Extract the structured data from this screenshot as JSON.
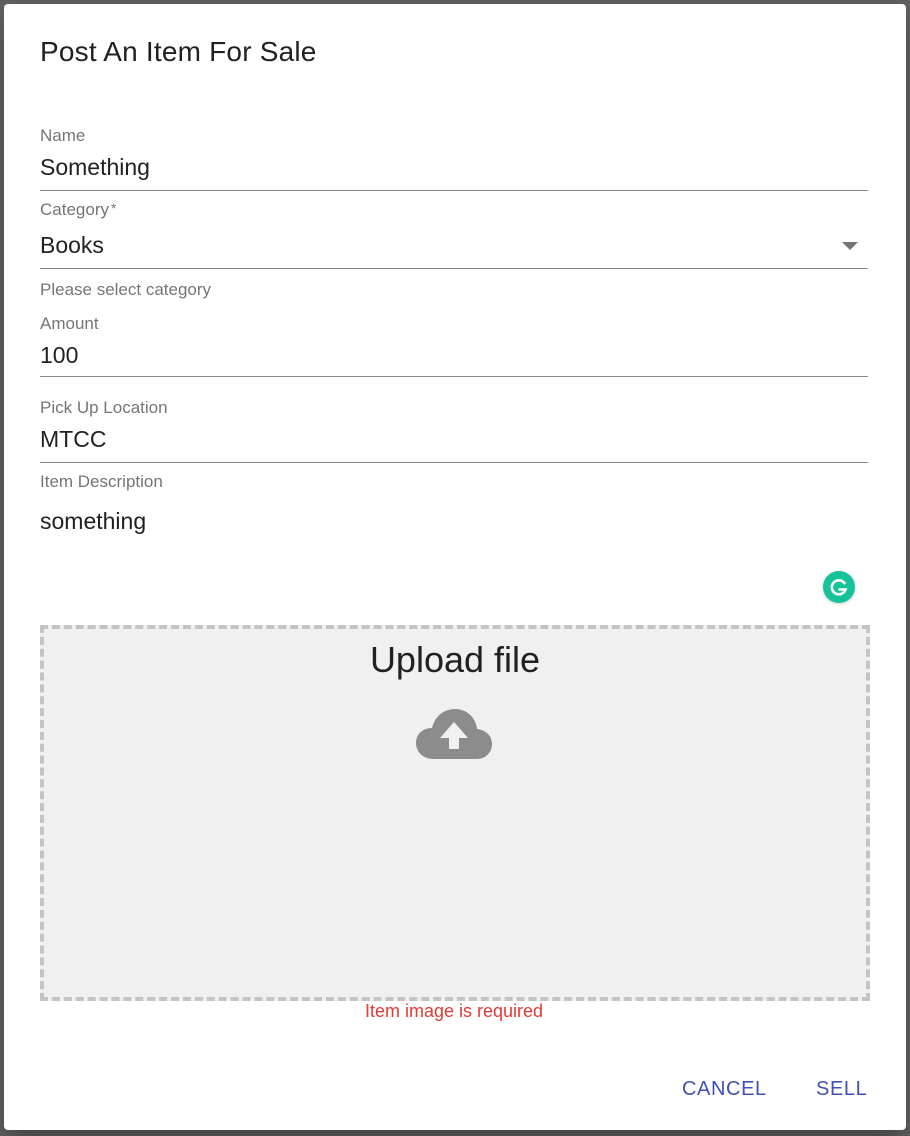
{
  "dialog": {
    "title": "Post An Item For Sale"
  },
  "form": {
    "name": {
      "label": "Name",
      "value": "Something"
    },
    "category": {
      "label": "Category",
      "required_mark": "*",
      "value": "Books",
      "helper": "Please select category"
    },
    "amount": {
      "label": "Amount",
      "value": "100"
    },
    "pickup": {
      "label": "Pick Up Location",
      "value": "MTCC"
    },
    "description": {
      "label": "Item Description",
      "value": "something"
    }
  },
  "upload": {
    "title": "Upload file",
    "icon": "cloud-upload-icon",
    "error": "Item image is required"
  },
  "actions": {
    "cancel_label": "CANCEL",
    "sell_label": "SELL"
  },
  "colors": {
    "primary": "#3f51b5",
    "error": "#e53935",
    "grammarly": "#15c39a"
  }
}
